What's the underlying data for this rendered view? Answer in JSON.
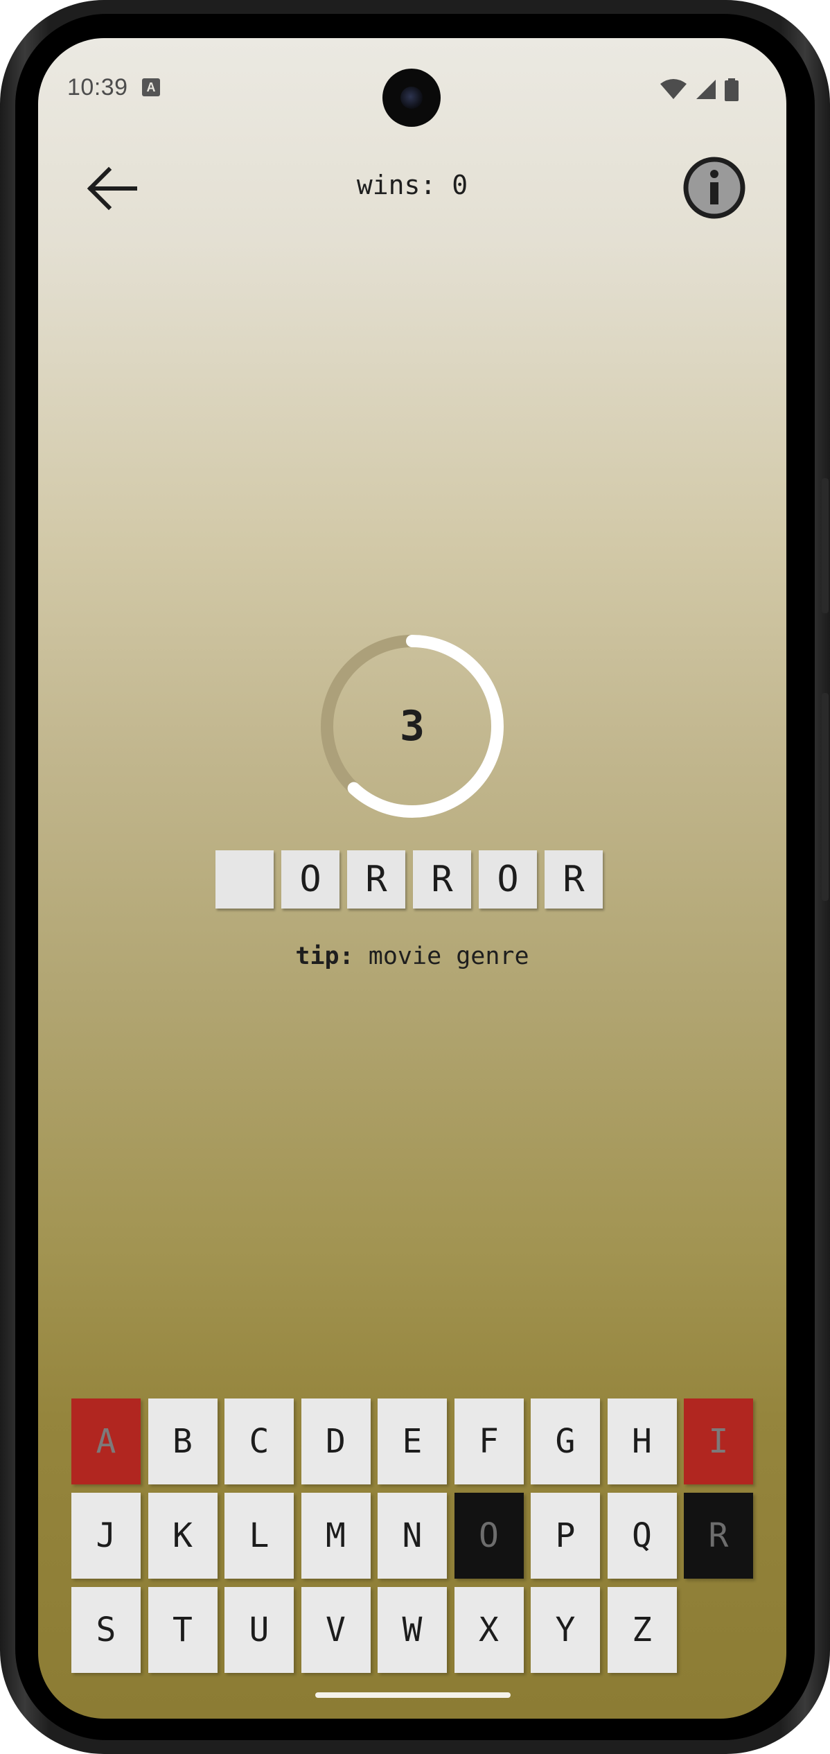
{
  "status_bar": {
    "time": "10:39",
    "notification_icon": "A",
    "icons": [
      "wifi-icon",
      "cell-signal-icon",
      "battery-icon"
    ]
  },
  "app_bar": {
    "back_icon": "arrow-left-icon",
    "wins_text": "wins: 0",
    "info_icon": "info-icon"
  },
  "timer": {
    "value": "3",
    "progress_fraction": 0.62,
    "track_color": "#aca07a",
    "fill_color": "#ffffff"
  },
  "word": {
    "tiles": [
      "",
      "O",
      "R",
      "R",
      "O",
      "R"
    ]
  },
  "tip": {
    "label": "tip:",
    "text": "movie genre"
  },
  "keyboard": {
    "rows": [
      [
        {
          "letter": "A",
          "state": "wrong"
        },
        {
          "letter": "B",
          "state": "unused"
        },
        {
          "letter": "C",
          "state": "unused"
        },
        {
          "letter": "D",
          "state": "unused"
        },
        {
          "letter": "E",
          "state": "unused"
        },
        {
          "letter": "F",
          "state": "unused"
        },
        {
          "letter": "G",
          "state": "unused"
        },
        {
          "letter": "H",
          "state": "unused"
        },
        {
          "letter": "I",
          "state": "wrong"
        }
      ],
      [
        {
          "letter": "J",
          "state": "unused"
        },
        {
          "letter": "K",
          "state": "unused"
        },
        {
          "letter": "L",
          "state": "unused"
        },
        {
          "letter": "M",
          "state": "unused"
        },
        {
          "letter": "N",
          "state": "unused"
        },
        {
          "letter": "O",
          "state": "correct"
        },
        {
          "letter": "P",
          "state": "unused"
        },
        {
          "letter": "Q",
          "state": "unused"
        },
        {
          "letter": "R",
          "state": "correct"
        }
      ],
      [
        {
          "letter": "S",
          "state": "unused"
        },
        {
          "letter": "T",
          "state": "unused"
        },
        {
          "letter": "U",
          "state": "unused"
        },
        {
          "letter": "V",
          "state": "unused"
        },
        {
          "letter": "W",
          "state": "unused"
        },
        {
          "letter": "X",
          "state": "unused"
        },
        {
          "letter": "Y",
          "state": "unused"
        },
        {
          "letter": "Z",
          "state": "unused"
        }
      ]
    ],
    "colors": {
      "wrong": "#b12620",
      "correct": "#121212",
      "unused": "#e9e9e9"
    }
  }
}
